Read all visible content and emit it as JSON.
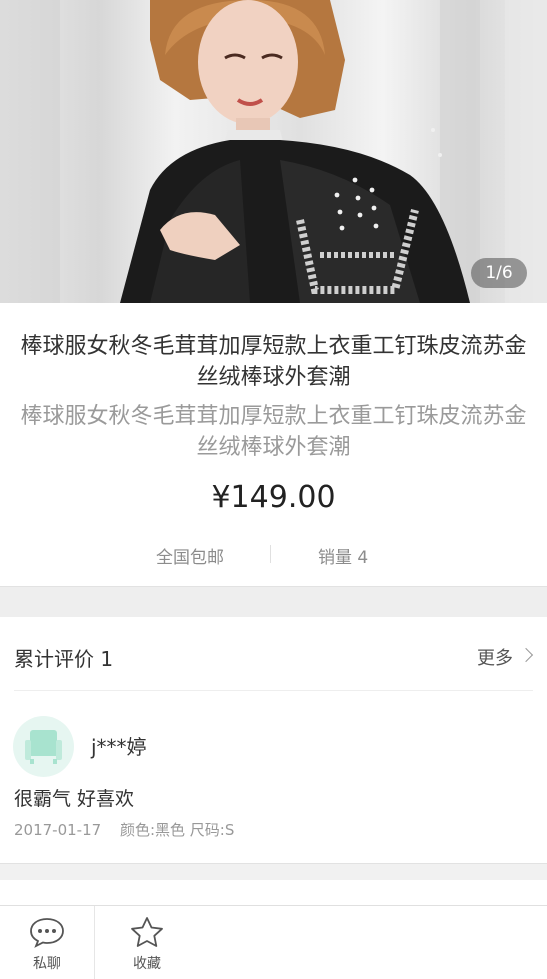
{
  "gallery": {
    "page_indicator": "1/6"
  },
  "product": {
    "title": "棒球服女秋冬毛茸茸加厚短款上衣重工钉珠皮流苏金丝绒棒球外套潮",
    "subtitle": "棒球服女秋冬毛茸茸加厚短款上衣重工钉珠皮流苏金丝绒棒球外套潮",
    "price": "¥149.00",
    "shipping": "全国包邮",
    "sales": "销量 4"
  },
  "reviews": {
    "title": "累计评价 1",
    "more_label": "更多",
    "items": [
      {
        "user": "j***婷",
        "text": "很霸气 好喜欢",
        "date": "2017-01-17",
        "spec": "颜色:黑色 尺码:S"
      }
    ]
  },
  "bottom_bar": {
    "chat_label": "私聊",
    "favorite_label": "收藏"
  },
  "colors": {
    "avatar_bg": "#e6f6f1",
    "avatar_icon": "#a8e3cf"
  }
}
